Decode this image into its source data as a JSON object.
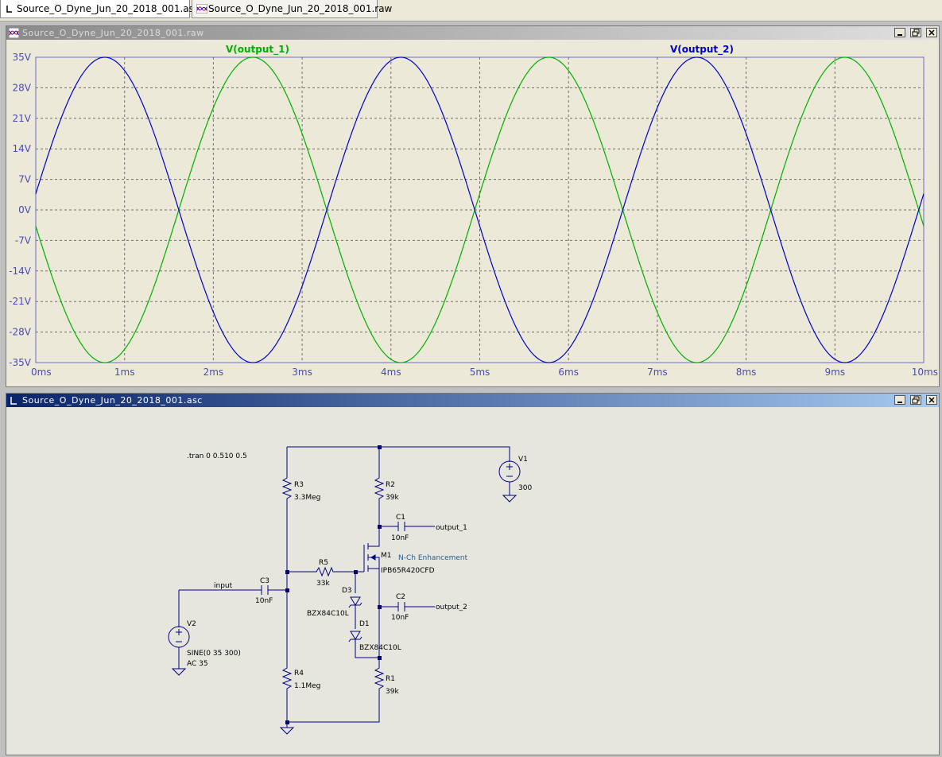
{
  "tabs": [
    {
      "label": "Source_O_Dyne_Jun_20_2018_001.asc",
      "active": true
    },
    {
      "label": "Source_O_Dyne_Jun_20_2018_001.raw",
      "active": false
    }
  ],
  "waveform_window": {
    "title": "Source_O_Dyne_Jun_20_2018_001.raw",
    "traces": [
      {
        "label": "V(output_1)",
        "color": "#00b000"
      },
      {
        "label": "V(output_2)",
        "color": "#0000c8"
      }
    ]
  },
  "schematic_window": {
    "title": "Source_O_Dyne_Jun_20_2018_001.asc",
    "directive": ".tran 0 0.510 0.5",
    "components": {
      "R3": {
        "name": "R3",
        "value": "3.3Meg"
      },
      "R2": {
        "name": "R2",
        "value": "39k"
      },
      "V1": {
        "name": "V1",
        "value": "300"
      },
      "C1": {
        "name": "C1",
        "value": "10nF"
      },
      "M1": {
        "name": "M1",
        "type": "N-Ch Enhancement",
        "part": "IPB65R420CFD"
      },
      "R5": {
        "name": "R5",
        "value": "33k"
      },
      "C3": {
        "name": "C3",
        "value": "10nF"
      },
      "D3": {
        "name": "D3",
        "part": "BZX84C10L"
      },
      "C2": {
        "name": "C2",
        "value": "10nF"
      },
      "D1": {
        "name": "D1",
        "part": "BZX84C10L"
      },
      "V2": {
        "name": "V2",
        "value": "SINE(0 35 300)",
        "ac": "AC 35"
      },
      "R4": {
        "name": "R4",
        "value": "1.1Meg"
      },
      "R1": {
        "name": "R1",
        "value": "39k"
      }
    },
    "net_labels": {
      "input": "input",
      "output_1": "output_1",
      "output_2": "output_2"
    }
  },
  "chart_data": {
    "type": "line",
    "x_unit": "ms",
    "xlim": [
      0,
      10
    ],
    "ylim": [
      -35,
      35
    ],
    "x_ticks": [
      "0ms",
      "1ms",
      "2ms",
      "3ms",
      "4ms",
      "5ms",
      "6ms",
      "7ms",
      "8ms",
      "9ms",
      "10ms"
    ],
    "y_ticks": [
      "35V",
      "28V",
      "21V",
      "14V",
      "7V",
      "0V",
      "-7V",
      "-14V",
      "-21V",
      "-28V",
      "-35V"
    ],
    "grid": true,
    "series": [
      {
        "name": "V(output_1)",
        "color": "#00b000",
        "amplitude_V": 35,
        "frequency_Hz": 300,
        "phase_deg": 180,
        "x": [
          0,
          0.833,
          1.667,
          2.5,
          3.333,
          4.167,
          5.0,
          5.833,
          6.667,
          7.5,
          8.333,
          9.167,
          10.0
        ],
        "y": [
          -3.7,
          -35,
          0,
          35,
          0,
          -35,
          0,
          35,
          0,
          -35,
          0,
          35,
          0
        ]
      },
      {
        "name": "V(output_2)",
        "color": "#0000c8",
        "amplitude_V": 35,
        "frequency_Hz": 300,
        "phase_deg": 0,
        "x": [
          0,
          0.833,
          1.667,
          2.5,
          3.333,
          4.167,
          5.0,
          5.833,
          6.667,
          7.5,
          8.333,
          9.167,
          10.0
        ],
        "y": [
          3.7,
          35,
          0,
          -35,
          0,
          35,
          0,
          -35,
          0,
          35,
          0,
          -35,
          0
        ]
      }
    ]
  }
}
